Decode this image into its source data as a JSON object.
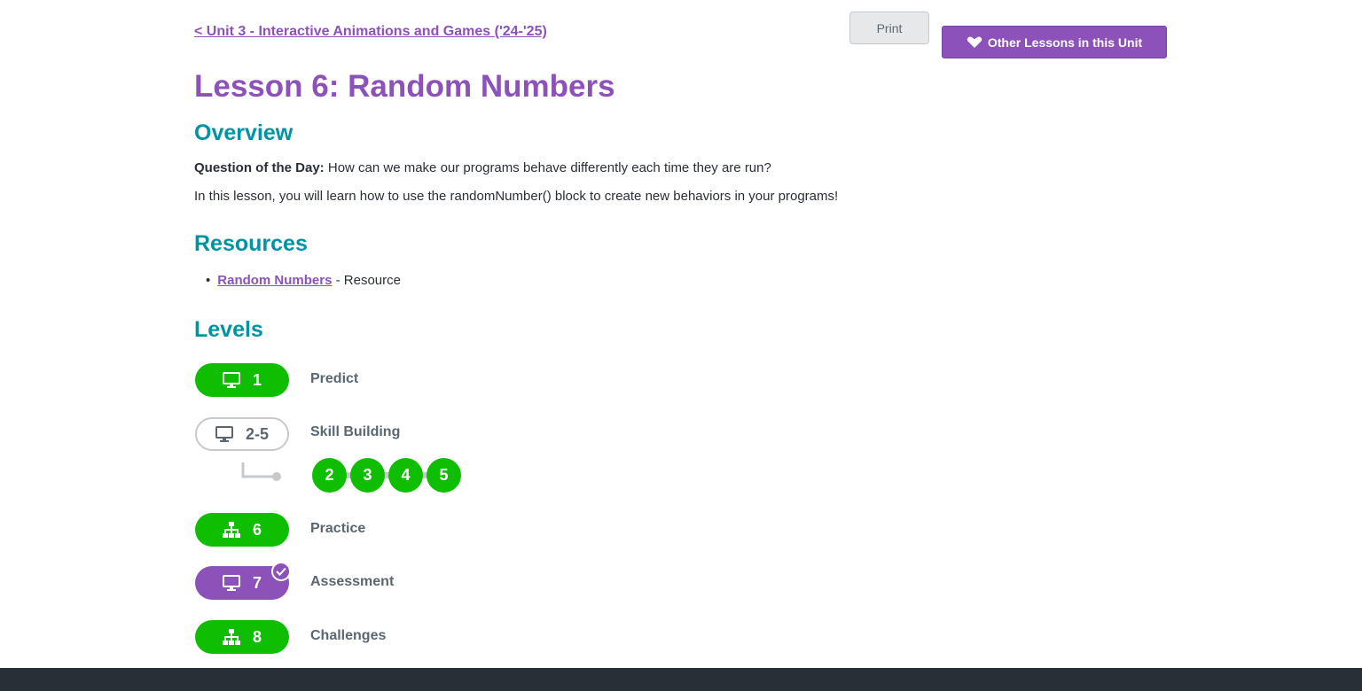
{
  "nav": {
    "unit_link": "< Unit 3 - Interactive Animations and Games ('24-'25)",
    "print_label": "Print",
    "other_lessons_label": "Other Lessons in this Unit"
  },
  "lesson": {
    "title": "Lesson 6: Random Numbers"
  },
  "overview": {
    "heading": "Overview",
    "qotd_label": "Question of the Day:",
    "qotd_text": " How can we make our programs behave differently each time they are run?",
    "description": "In this lesson, you will learn how to use the randomNumber() block to create new behaviors in your programs!"
  },
  "resources": {
    "heading": "Resources",
    "items": [
      {
        "link": "Random Numbers",
        "suffix": " - Resource"
      }
    ]
  },
  "levels": {
    "heading": "Levels",
    "items": [
      {
        "number": "1",
        "label": "Predict",
        "icon": "desktop-icon",
        "status": "complete"
      },
      {
        "number": "2-5",
        "label": "Skill Building",
        "icon": "desktop-icon",
        "status": "group"
      },
      {
        "number": "6",
        "label": "Practice",
        "icon": "sitemap-icon",
        "status": "complete"
      },
      {
        "number": "7",
        "label": "Assessment",
        "icon": "desktop-icon",
        "status": "assessment-submitted"
      },
      {
        "number": "8",
        "label": "Challenges",
        "icon": "sitemap-icon",
        "status": "complete"
      }
    ],
    "sublevels": [
      "2",
      "3",
      "4",
      "5"
    ]
  },
  "colors": {
    "brand_purple": "#8c52ba",
    "heading_teal": "#0094a3",
    "complete_green": "#0fbe00",
    "footer_dark": "#292f36"
  }
}
